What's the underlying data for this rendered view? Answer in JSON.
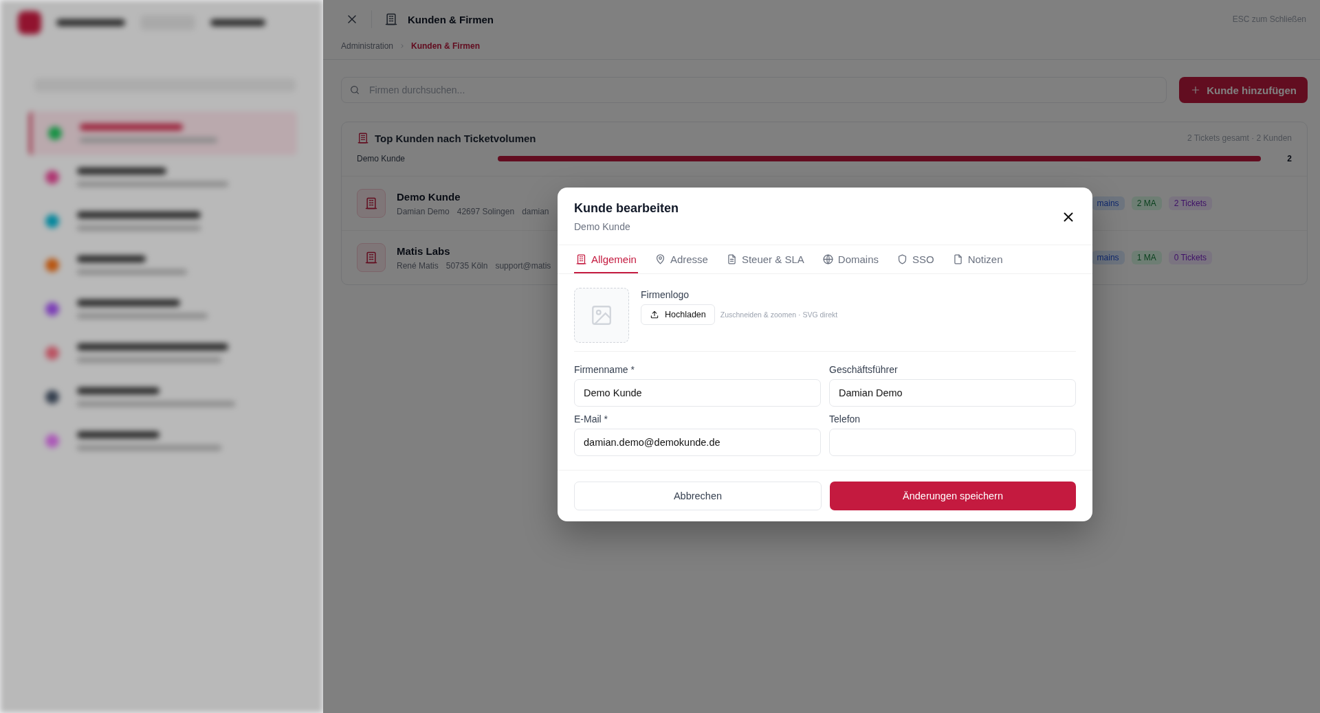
{
  "sidebar": {
    "items": [
      {
        "selected": true
      },
      {
        "selected": false
      },
      {
        "selected": false
      },
      {
        "selected": false
      },
      {
        "selected": false
      },
      {
        "selected": false
      },
      {
        "selected": false
      },
      {
        "selected": false
      }
    ]
  },
  "panel": {
    "title": "Kunden & Firmen",
    "hint": "ESC zum Schließen",
    "breadcrumb": [
      {
        "label": "Administration",
        "current": false
      },
      {
        "label": "Kunden & Firmen",
        "current": true
      }
    ],
    "search": {
      "placeholder": "Firmen durchsuchen..."
    },
    "add_button": "Kunde hinzufügen",
    "top_customers": {
      "title": "Top Kunden nach Ticketvolumen",
      "summary": "2 Tickets gesamt · 2 Kunden",
      "bars": [
        {
          "name": "Demo Kunde",
          "level": 1,
          "count": "2"
        }
      ]
    },
    "customers": [
      {
        "name": "Demo Kunde",
        "meta": [
          "Damian Demo",
          "42697 Solingen",
          "damian"
        ],
        "badges": [
          {
            "text": "mains",
            "kind": "domains"
          },
          {
            "text": "2 MA",
            "kind": "staff"
          },
          {
            "text": "2 Tickets",
            "kind": "tickets"
          }
        ]
      },
      {
        "name": "Matis Labs",
        "meta": [
          "René Matis",
          "50735 Köln",
          "support@matis"
        ],
        "badges": [
          {
            "text": "mains",
            "kind": "domains"
          },
          {
            "text": "1 MA",
            "kind": "staff"
          },
          {
            "text": "0 Tickets",
            "kind": "tickets"
          }
        ]
      }
    ]
  },
  "modal": {
    "title": "Kunde bearbeiten",
    "subtitle": "Demo Kunde",
    "tabs": [
      {
        "label": "Allgemein",
        "selected": true
      },
      {
        "label": "Adresse",
        "selected": false
      },
      {
        "label": "Steuer & SLA",
        "selected": false
      },
      {
        "label": "Domains",
        "selected": false
      },
      {
        "label": "SSO",
        "selected": false
      },
      {
        "label": "Notizen",
        "selected": false
      }
    ],
    "logo": {
      "label": "Firmenlogo",
      "button": "Hochladen",
      "hint": "Zuschneiden & zoomen · SVG direkt"
    },
    "fields": [
      {
        "label": "Firmenname *",
        "value": "Demo Kunde"
      },
      {
        "label": "Geschäftsführer",
        "value": "Damian Demo"
      },
      {
        "label": "E-Mail *",
        "value": "damian.demo@demokunde.de"
      },
      {
        "label": "Telefon"
      }
    ],
    "buttons": [
      {
        "label": "Abbrechen",
        "kind": "secondary"
      },
      {
        "label": "Änderungen speichern",
        "kind": "primary"
      }
    ]
  }
}
